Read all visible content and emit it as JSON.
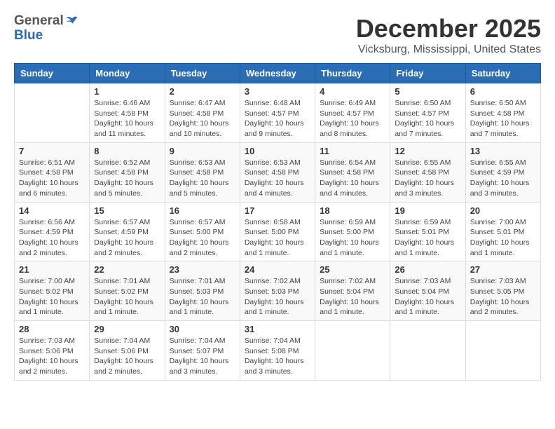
{
  "header": {
    "logo_general": "General",
    "logo_blue": "Blue",
    "month": "December 2025",
    "location": "Vicksburg, Mississippi, United States"
  },
  "calendar": {
    "days_of_week": [
      "Sunday",
      "Monday",
      "Tuesday",
      "Wednesday",
      "Thursday",
      "Friday",
      "Saturday"
    ],
    "weeks": [
      [
        {
          "date": "",
          "info": ""
        },
        {
          "date": "1",
          "info": "Sunrise: 6:46 AM\nSunset: 4:58 PM\nDaylight: 10 hours\nand 11 minutes."
        },
        {
          "date": "2",
          "info": "Sunrise: 6:47 AM\nSunset: 4:58 PM\nDaylight: 10 hours\nand 10 minutes."
        },
        {
          "date": "3",
          "info": "Sunrise: 6:48 AM\nSunset: 4:57 PM\nDaylight: 10 hours\nand 9 minutes."
        },
        {
          "date": "4",
          "info": "Sunrise: 6:49 AM\nSunset: 4:57 PM\nDaylight: 10 hours\nand 8 minutes."
        },
        {
          "date": "5",
          "info": "Sunrise: 6:50 AM\nSunset: 4:57 PM\nDaylight: 10 hours\nand 7 minutes."
        },
        {
          "date": "6",
          "info": "Sunrise: 6:50 AM\nSunset: 4:58 PM\nDaylight: 10 hours\nand 7 minutes."
        }
      ],
      [
        {
          "date": "7",
          "info": "Sunrise: 6:51 AM\nSunset: 4:58 PM\nDaylight: 10 hours\nand 6 minutes."
        },
        {
          "date": "8",
          "info": "Sunrise: 6:52 AM\nSunset: 4:58 PM\nDaylight: 10 hours\nand 5 minutes."
        },
        {
          "date": "9",
          "info": "Sunrise: 6:53 AM\nSunset: 4:58 PM\nDaylight: 10 hours\nand 5 minutes."
        },
        {
          "date": "10",
          "info": "Sunrise: 6:53 AM\nSunset: 4:58 PM\nDaylight: 10 hours\nand 4 minutes."
        },
        {
          "date": "11",
          "info": "Sunrise: 6:54 AM\nSunset: 4:58 PM\nDaylight: 10 hours\nand 4 minutes."
        },
        {
          "date": "12",
          "info": "Sunrise: 6:55 AM\nSunset: 4:58 PM\nDaylight: 10 hours\nand 3 minutes."
        },
        {
          "date": "13",
          "info": "Sunrise: 6:55 AM\nSunset: 4:59 PM\nDaylight: 10 hours\nand 3 minutes."
        }
      ],
      [
        {
          "date": "14",
          "info": "Sunrise: 6:56 AM\nSunset: 4:59 PM\nDaylight: 10 hours\nand 2 minutes."
        },
        {
          "date": "15",
          "info": "Sunrise: 6:57 AM\nSunset: 4:59 PM\nDaylight: 10 hours\nand 2 minutes."
        },
        {
          "date": "16",
          "info": "Sunrise: 6:57 AM\nSunset: 5:00 PM\nDaylight: 10 hours\nand 2 minutes."
        },
        {
          "date": "17",
          "info": "Sunrise: 6:58 AM\nSunset: 5:00 PM\nDaylight: 10 hours\nand 1 minute."
        },
        {
          "date": "18",
          "info": "Sunrise: 6:59 AM\nSunset: 5:00 PM\nDaylight: 10 hours\nand 1 minute."
        },
        {
          "date": "19",
          "info": "Sunrise: 6:59 AM\nSunset: 5:01 PM\nDaylight: 10 hours\nand 1 minute."
        },
        {
          "date": "20",
          "info": "Sunrise: 7:00 AM\nSunset: 5:01 PM\nDaylight: 10 hours\nand 1 minute."
        }
      ],
      [
        {
          "date": "21",
          "info": "Sunrise: 7:00 AM\nSunset: 5:02 PM\nDaylight: 10 hours\nand 1 minute."
        },
        {
          "date": "22",
          "info": "Sunrise: 7:01 AM\nSunset: 5:02 PM\nDaylight: 10 hours\nand 1 minute."
        },
        {
          "date": "23",
          "info": "Sunrise: 7:01 AM\nSunset: 5:03 PM\nDaylight: 10 hours\nand 1 minute."
        },
        {
          "date": "24",
          "info": "Sunrise: 7:02 AM\nSunset: 5:03 PM\nDaylight: 10 hours\nand 1 minute."
        },
        {
          "date": "25",
          "info": "Sunrise: 7:02 AM\nSunset: 5:04 PM\nDaylight: 10 hours\nand 1 minute."
        },
        {
          "date": "26",
          "info": "Sunrise: 7:03 AM\nSunset: 5:04 PM\nDaylight: 10 hours\nand 1 minute."
        },
        {
          "date": "27",
          "info": "Sunrise: 7:03 AM\nSunset: 5:05 PM\nDaylight: 10 hours\nand 2 minutes."
        }
      ],
      [
        {
          "date": "28",
          "info": "Sunrise: 7:03 AM\nSunset: 5:06 PM\nDaylight: 10 hours\nand 2 minutes."
        },
        {
          "date": "29",
          "info": "Sunrise: 7:04 AM\nSunset: 5:06 PM\nDaylight: 10 hours\nand 2 minutes."
        },
        {
          "date": "30",
          "info": "Sunrise: 7:04 AM\nSunset: 5:07 PM\nDaylight: 10 hours\nand 3 minutes."
        },
        {
          "date": "31",
          "info": "Sunrise: 7:04 AM\nSunset: 5:08 PM\nDaylight: 10 hours\nand 3 minutes."
        },
        {
          "date": "",
          "info": ""
        },
        {
          "date": "",
          "info": ""
        },
        {
          "date": "",
          "info": ""
        }
      ]
    ]
  }
}
